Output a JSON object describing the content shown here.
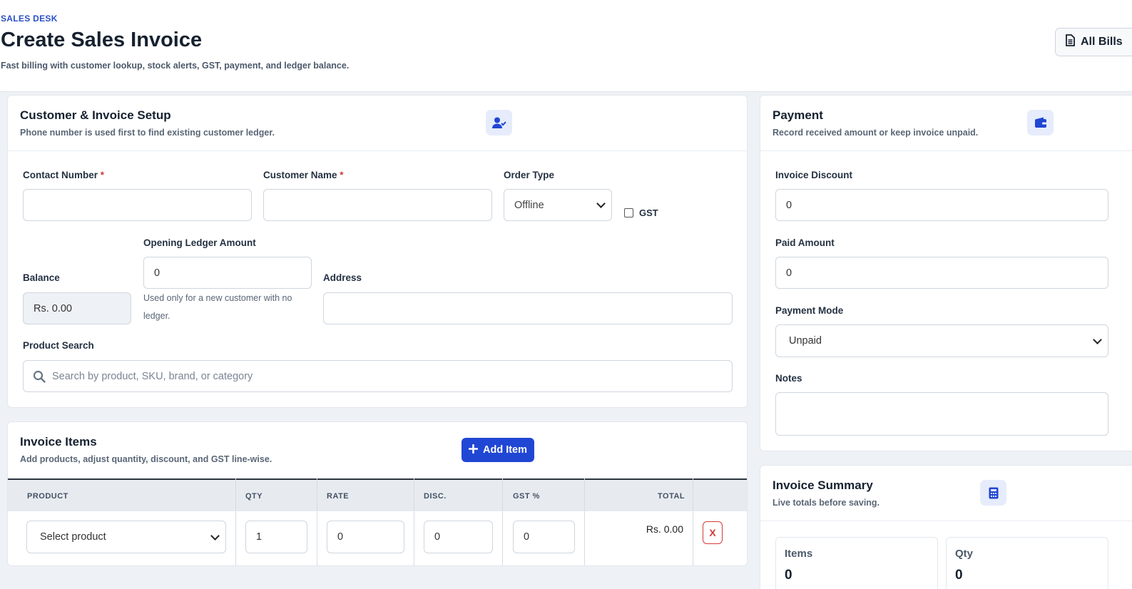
{
  "header": {
    "eyebrow": "SALES DESK",
    "title": "Create Sales Invoice",
    "subtitle": "Fast billing with customer lookup, stock alerts, GST, payment, and ledger balance.",
    "all_bills_label": "All Bills"
  },
  "customer_card": {
    "title": "Customer & Invoice Setup",
    "subtitle": "Phone number is used first to find existing customer ledger.",
    "contact_label": "Contact Number",
    "contact_value": "",
    "customer_name_label": "Customer Name",
    "customer_name_value": "",
    "required_mark": "*",
    "order_type_label": "Order Type",
    "order_type_value": "Offline",
    "gst_label": "GST",
    "gst_checked": false,
    "balance_label": "Balance",
    "balance_value": "Rs. 0.00",
    "opening_ledger_label": "Opening Ledger Amount",
    "opening_ledger_value": "0",
    "opening_ledger_help_1": "Used only for a new customer with no",
    "opening_ledger_help_2": "ledger.",
    "address_label": "Address",
    "address_value": "",
    "product_search_label": "Product Search",
    "product_search_placeholder": "Search by product, SKU, brand, or category"
  },
  "items_card": {
    "title": "Invoice Items",
    "subtitle": "Add products, adjust quantity, discount, and GST line-wise.",
    "add_item_label": "Add Item",
    "columns": [
      "PRODUCT",
      "QTY",
      "RATE",
      "DISC.",
      "GST %",
      "TOTAL"
    ],
    "row": {
      "product": "Select product",
      "qty": "1",
      "rate": "0",
      "disc": "0",
      "gst": "0",
      "total": "Rs. 0.00",
      "delete_label": "X"
    }
  },
  "payment_card": {
    "title": "Payment",
    "subtitle": "Record received amount or keep invoice unpaid.",
    "discount_label": "Invoice Discount",
    "discount_value": "0",
    "paid_label": "Paid Amount",
    "paid_value": "0",
    "mode_label": "Payment Mode",
    "mode_value": "Unpaid",
    "notes_label": "Notes",
    "notes_value": ""
  },
  "summary_card": {
    "title": "Invoice Summary",
    "subtitle": "Live totals before saving.",
    "items_label": "Items",
    "items_value": "0",
    "qty_label": "Qty",
    "qty_value": "0"
  },
  "colors": {
    "accent": "#2046d4",
    "danger": "#d23b3b",
    "background": "#eef1f5"
  },
  "icons": [
    "file-icon",
    "user-check-icon",
    "plus-icon",
    "search-icon",
    "wallet-icon",
    "calculator-icon",
    "chevron-down-icon"
  ]
}
